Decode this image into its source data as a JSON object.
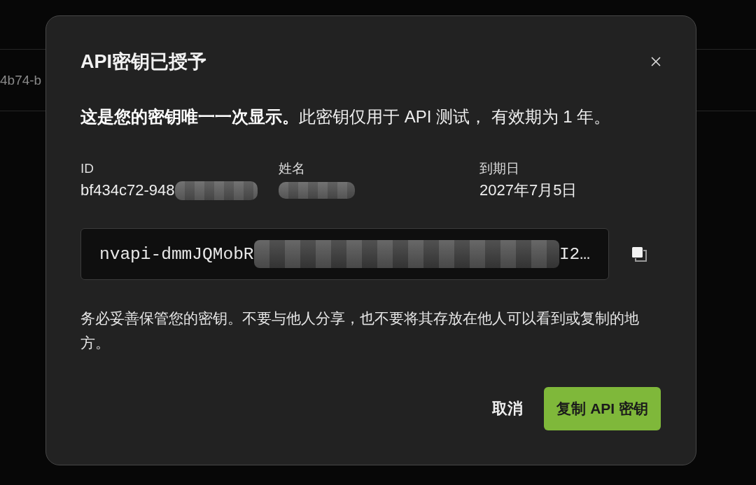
{
  "background_table": {
    "rows": [
      {
        "cell": "4b74-b"
      }
    ]
  },
  "dialog": {
    "title": "API密钥已授予",
    "intro": "**这是您的密钥唯一一次显示。**此密钥仅用于 API 测试， 有效期为 1 年。",
    "fields": [
      {
        "label": "ID",
        "value": "bf434c72-948",
        "redacted": true
      },
      {
        "label": "姓名",
        "redacted": true
      },
      {
        "label": "到期日",
        "value": "2027年7月5日",
        "redacted": false
      }
    ],
    "api_key": {
      "start": "nvapi-dmmJQMobR",
      "end": "I2…",
      "redacted": true
    },
    "warning": "务必妥善保管您的密钥。不要与他人分享，也不要将其存放在他人可以看到或复制的地方。",
    "buttons": [
      {
        "kind": "text",
        "label": "取消"
      },
      {
        "kind": "primary",
        "label": "复制 API 密钥"
      }
    ]
  }
}
